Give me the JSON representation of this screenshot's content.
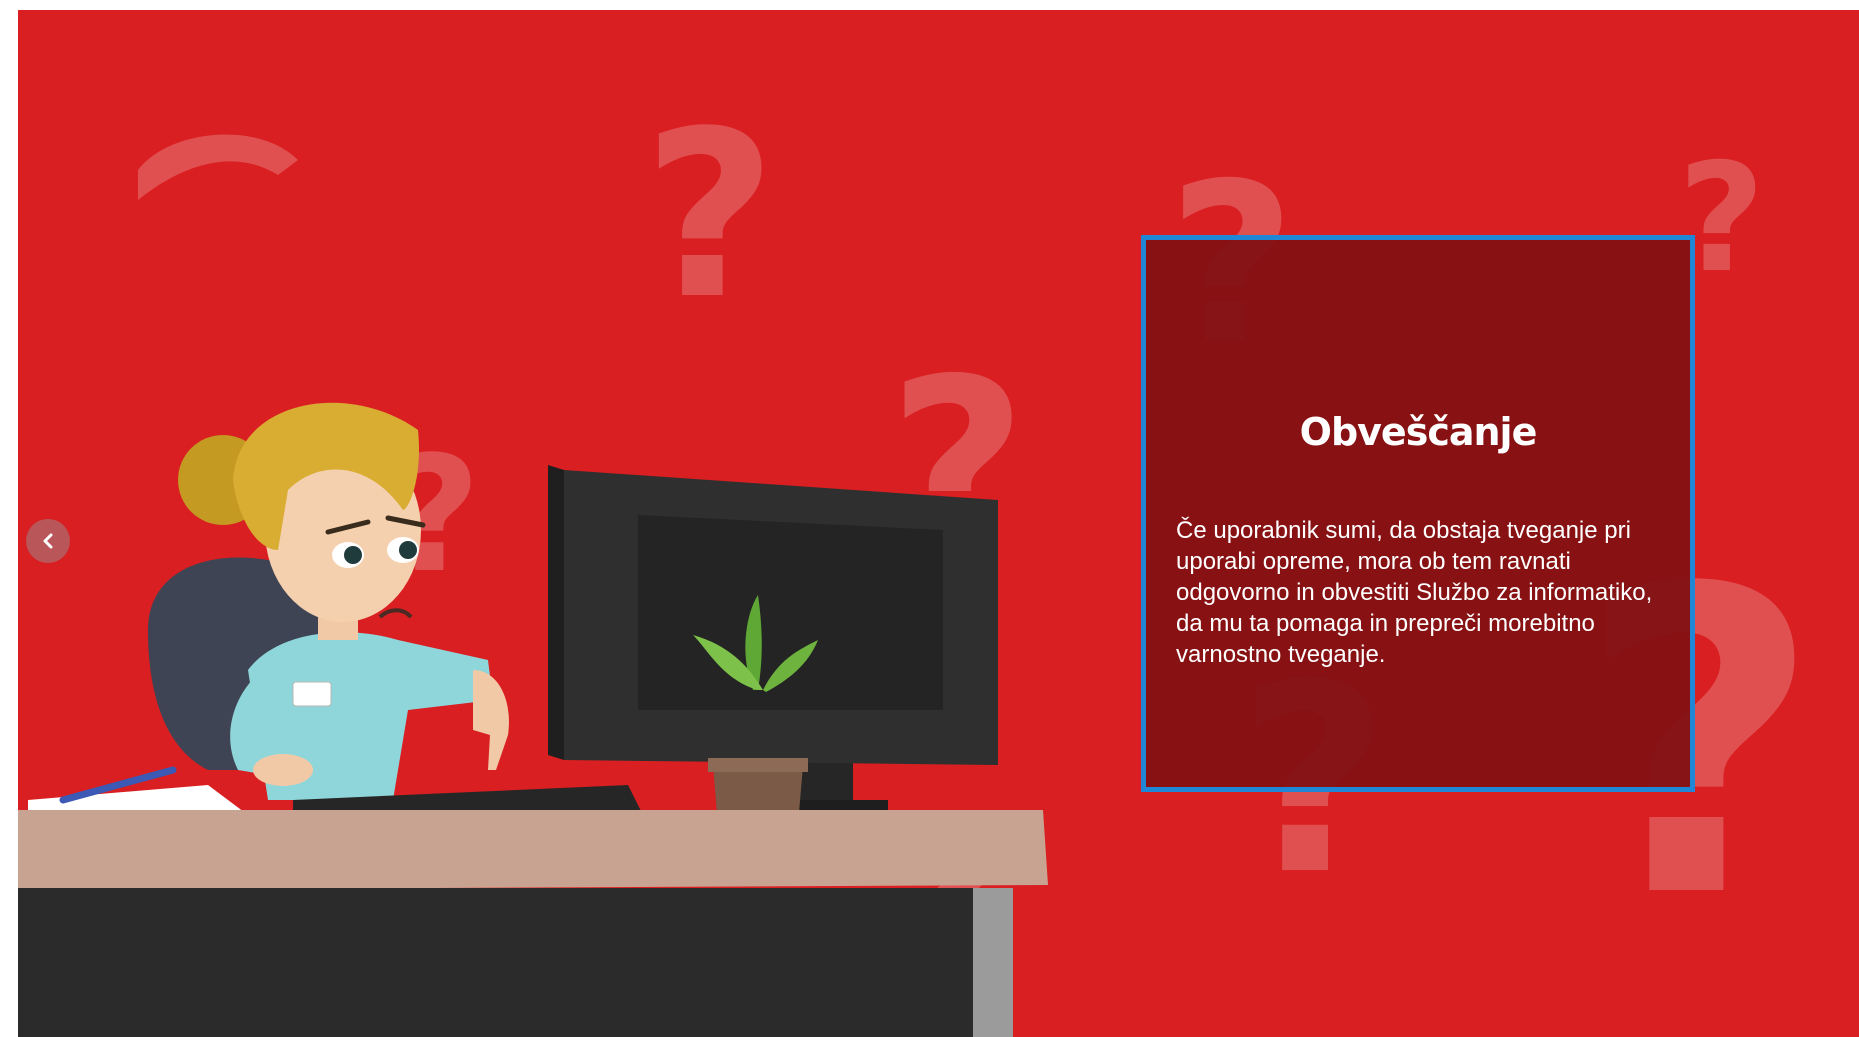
{
  "slide": {
    "background_color": "#d91f21"
  },
  "card": {
    "title": "Obveščanje",
    "body": "Če uporabnik sumi, da obstaja tveganje pri uporabi opreme, mora ob tem ravnati odgovorno in obvestiti Službo za informatiko, da mu ta pomaga in prepreči morebitno varnostno tveganje.",
    "background_color": "#801012",
    "border_color": "#1f87d6"
  },
  "navigation": {
    "prev_icon": "chevron-left-icon"
  }
}
